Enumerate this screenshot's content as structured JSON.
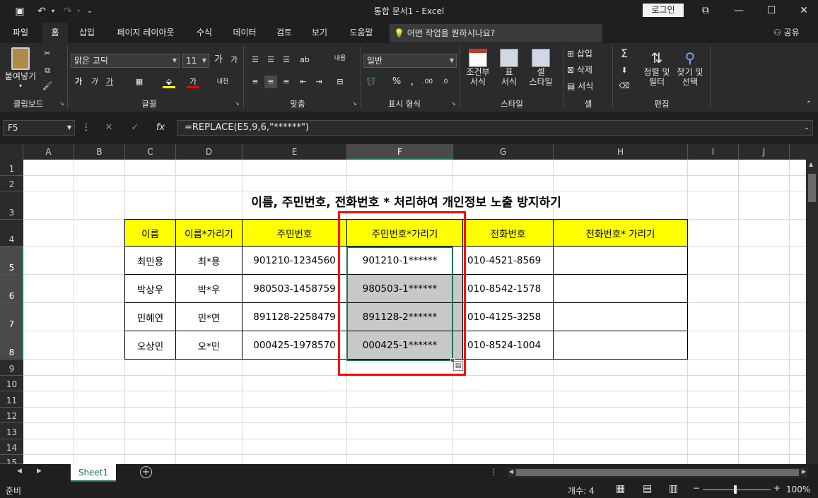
{
  "window": {
    "title": "통합 문서1  -  Excel",
    "login_label": "로그인",
    "controls": [
      "⧉",
      "—",
      "☐",
      "✕"
    ]
  },
  "tabs": [
    {
      "label": "파일"
    },
    {
      "label": "홈",
      "active": true
    },
    {
      "label": "삽입"
    },
    {
      "label": "페이지 레이아웃"
    },
    {
      "label": "수식"
    },
    {
      "label": "데이터"
    },
    {
      "label": "검토"
    },
    {
      "label": "보기"
    },
    {
      "label": "도움말"
    }
  ],
  "tellme": "어떤 작업을 원하시나요?",
  "share": "공유",
  "ribbon": {
    "clipboard": {
      "paste": "붙여넣기",
      "group": "클립보드"
    },
    "font": {
      "name": "맑은 고딕",
      "size": "11",
      "bold": "가",
      "italic": "가",
      "underline": "가",
      "font_color": "가",
      "group": "글꼴"
    },
    "align": {
      "group": "맞춤",
      "wrap": "내용"
    },
    "number": {
      "format": "일반",
      "group": "표시 형식"
    },
    "styles": {
      "cond": "조건부",
      "cond2": "서식",
      "table": "표",
      "table2": "서식",
      "cell": "셀",
      "cell2": "스타일",
      "group": "스타일"
    },
    "cells": {
      "insert": "삽입",
      "delete": "삭제",
      "format": "서식",
      "group": "셀"
    },
    "editing": {
      "sort": "정렬 및",
      "sort2": "필터",
      "find": "찾기 및",
      "find2": "선택",
      "group": "편집"
    }
  },
  "formula_bar": {
    "name_box": "F5",
    "formula": "=REPLACE(E5,9,6,\"******\")"
  },
  "columns": [
    "A",
    "B",
    "C",
    "D",
    "E",
    "F",
    "G",
    "H",
    "I",
    "J"
  ],
  "rows": [
    "1",
    "2",
    "3",
    "4",
    "5",
    "6",
    "7",
    "8",
    "9",
    "10",
    "11",
    "12",
    "13",
    "14",
    "15"
  ],
  "sheet": {
    "title": "이름, 주민번호, 전화번호 * 처리하여 개인정보 노출 방지하기",
    "headers": [
      "이름",
      "이름*가리기",
      "주민번호",
      "주민번호*가리기",
      "전화번호",
      "전화번호* 가리기"
    ],
    "data": [
      [
        "최민용",
        "최*용",
        "901210-1234560",
        "901210-1******",
        "010-4521-8569",
        ""
      ],
      [
        "박상우",
        "박*우",
        "980503-1458759",
        "980503-1******",
        "010-8542-1578",
        ""
      ],
      [
        "민혜연",
        "민*연",
        "891128-2258479",
        "891128-2******",
        "010-4125-3258",
        ""
      ],
      [
        "오상민",
        "오*민",
        "000425-1978570",
        "000425-1******",
        "010-8524-1004",
        ""
      ]
    ]
  },
  "sheet_tab": "Sheet1",
  "status": {
    "ready": "준비",
    "count": "개수: 4",
    "zoom": "100%"
  }
}
